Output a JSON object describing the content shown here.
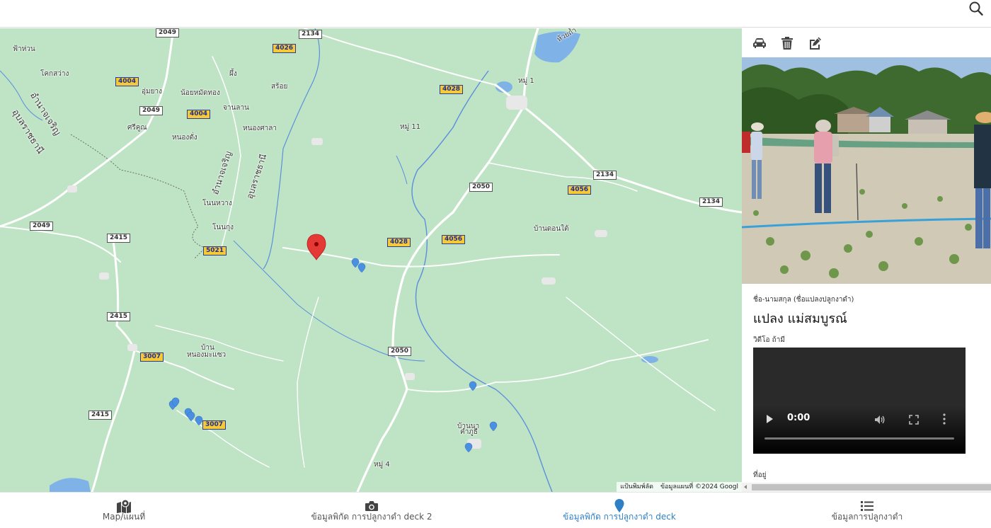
{
  "header": {
    "search_icon": "search-icon"
  },
  "map": {
    "places": [
      {
        "id": "p1",
        "label": "ฟ้าห่วน"
      },
      {
        "id": "p2",
        "label": "โคกสว่าง"
      },
      {
        "id": "p3",
        "label": "อำนาจเจริญ"
      },
      {
        "id": "p4",
        "label": "อุบลราชธานี"
      },
      {
        "id": "p5",
        "label": "อุ่มยาง"
      },
      {
        "id": "p6",
        "label": "น้อยหมัดทอง"
      },
      {
        "id": "p7",
        "label": "ผึ้ง"
      },
      {
        "id": "p8",
        "label": "สร้อย"
      },
      {
        "id": "p9",
        "label": "จานลาน"
      },
      {
        "id": "p10",
        "label": "ศรีคูณ"
      },
      {
        "id": "p11",
        "label": "หนองตั่ง"
      },
      {
        "id": "p12",
        "label": "หนองศาลา"
      },
      {
        "id": "p13",
        "label": "อำนาจเจริญ"
      },
      {
        "id": "p14",
        "label": "อุบลราชธานี"
      },
      {
        "id": "p15",
        "label": "โนนหวาง"
      },
      {
        "id": "p16",
        "label": "โนนกุง"
      },
      {
        "id": "p17",
        "label": "หมู่ 11"
      },
      {
        "id": "p18",
        "label": "หมู่ 1"
      },
      {
        "id": "p19",
        "label": "บ้านดอนใต้"
      },
      {
        "id": "p20",
        "label": "บ้าน"
      },
      {
        "id": "p21",
        "label": "หนองมะแซว"
      },
      {
        "id": "p22",
        "label": "บ้านนา"
      },
      {
        "id": "p23",
        "label": "คำภูธี"
      },
      {
        "id": "p24",
        "label": "หมู่ 4"
      },
      {
        "id": "p25",
        "label": "ห้วยถ้ำ"
      }
    ],
    "roads": [
      {
        "id": "r1",
        "label": "2049"
      },
      {
        "id": "r2",
        "label": "2134"
      },
      {
        "id": "r3",
        "label": "4026"
      },
      {
        "id": "r4",
        "label": "4004"
      },
      {
        "id": "r5",
        "label": "2049"
      },
      {
        "id": "r6",
        "label": "4004"
      },
      {
        "id": "r7",
        "label": "4028"
      },
      {
        "id": "r8",
        "label": "2050"
      },
      {
        "id": "r9",
        "label": "2134"
      },
      {
        "id": "r10",
        "label": "4056"
      },
      {
        "id": "r11",
        "label": "2134"
      },
      {
        "id": "r12",
        "label": "2049"
      },
      {
        "id": "r13",
        "label": "2415"
      },
      {
        "id": "r14",
        "label": "5021"
      },
      {
        "id": "r15",
        "label": "4028"
      },
      {
        "id": "r16",
        "label": "4056"
      },
      {
        "id": "r17",
        "label": "2415"
      },
      {
        "id": "r18",
        "label": "3007"
      },
      {
        "id": "r19",
        "label": "2050"
      },
      {
        "id": "r20",
        "label": "3007"
      },
      {
        "id": "r21",
        "label": "2415"
      }
    ],
    "selected_marker_color": "#e53935",
    "marker_color": "#4a90e2",
    "footer": {
      "shortcuts": "แป้นพิมพ์ลัด",
      "attribution": "ข้อมูลแผนที่ ©2024 Googl"
    }
  },
  "panel": {
    "tools": [
      "car-icon",
      "trash-icon",
      "edit-icon"
    ],
    "name_label": "ชื่อ-นามสกุล (ชื่อแปลงปลูกงาดำ)",
    "name_value": "แปลง แม่สมบูรณ์",
    "video_label": "วิดีโอ ถ้ามี",
    "video_time": "0:00",
    "address_label": "ที่อยู่"
  },
  "nav": {
    "items": [
      {
        "label": "Map/แผนที่",
        "icon": "map-icon",
        "active": false
      },
      {
        "label": "ข้อมูลพิกัด การปลูกงาดำ deck 2",
        "icon": "camera-icon",
        "active": false
      },
      {
        "label": "ข้อมูลพิกัด การปลูกงาดำ deck",
        "icon": "map-pin-icon",
        "active": true
      },
      {
        "label": "ข้อมูลการปลูกงาดำ",
        "icon": "list-icon",
        "active": false
      }
    ],
    "active_color": "#2f7fc6"
  }
}
